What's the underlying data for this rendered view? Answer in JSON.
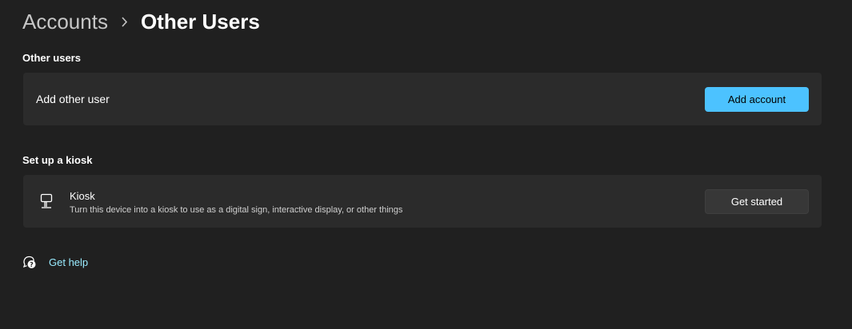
{
  "breadcrumb": {
    "parent": "Accounts",
    "separator_icon": "chevron-right-icon",
    "current": "Other Users"
  },
  "other_users": {
    "section_title": "Other users",
    "add_user_label": "Add other user",
    "add_account_button": "Add account"
  },
  "kiosk": {
    "section_title": "Set up a kiosk",
    "icon": "kiosk-icon",
    "title": "Kiosk",
    "description": "Turn this device into a kiosk to use as a digital sign, interactive display, or other things",
    "button": "Get started"
  },
  "help": {
    "icon": "get-help-icon",
    "label": "Get help"
  },
  "colors": {
    "background": "#202020",
    "card": "#2b2b2b",
    "accent": "#4cc2ff",
    "link": "#99ebff"
  }
}
